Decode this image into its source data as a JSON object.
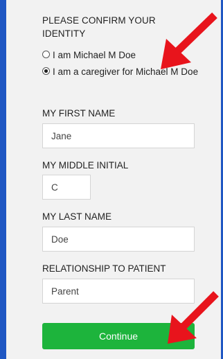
{
  "identity": {
    "heading": "PLEASE CONFIRM YOUR IDENTITY",
    "options": [
      {
        "label": "I am Michael M Doe",
        "selected": false
      },
      {
        "label": "I am a caregiver for Michael M Doe",
        "selected": true
      }
    ]
  },
  "form": {
    "first_name": {
      "label": "MY FIRST NAME",
      "value": "Jane"
    },
    "middle_initial": {
      "label": "MY MIDDLE INITIAL",
      "value": "C"
    },
    "last_name": {
      "label": "MY LAST NAME",
      "value": "Doe"
    },
    "relationship": {
      "label": "RELATIONSHIP TO PATIENT",
      "value": "Parent"
    }
  },
  "actions": {
    "continue_label": "Continue"
  },
  "colors": {
    "frame": "#1f57c3",
    "panel": "#f2f2f2",
    "button": "#1db43c",
    "annotation_arrow": "#e8141c"
  },
  "annotations": [
    {
      "name": "red-arrow",
      "points_to": "caregiver-radio-option"
    },
    {
      "name": "red-arrow",
      "points_to": "continue-button"
    }
  ]
}
